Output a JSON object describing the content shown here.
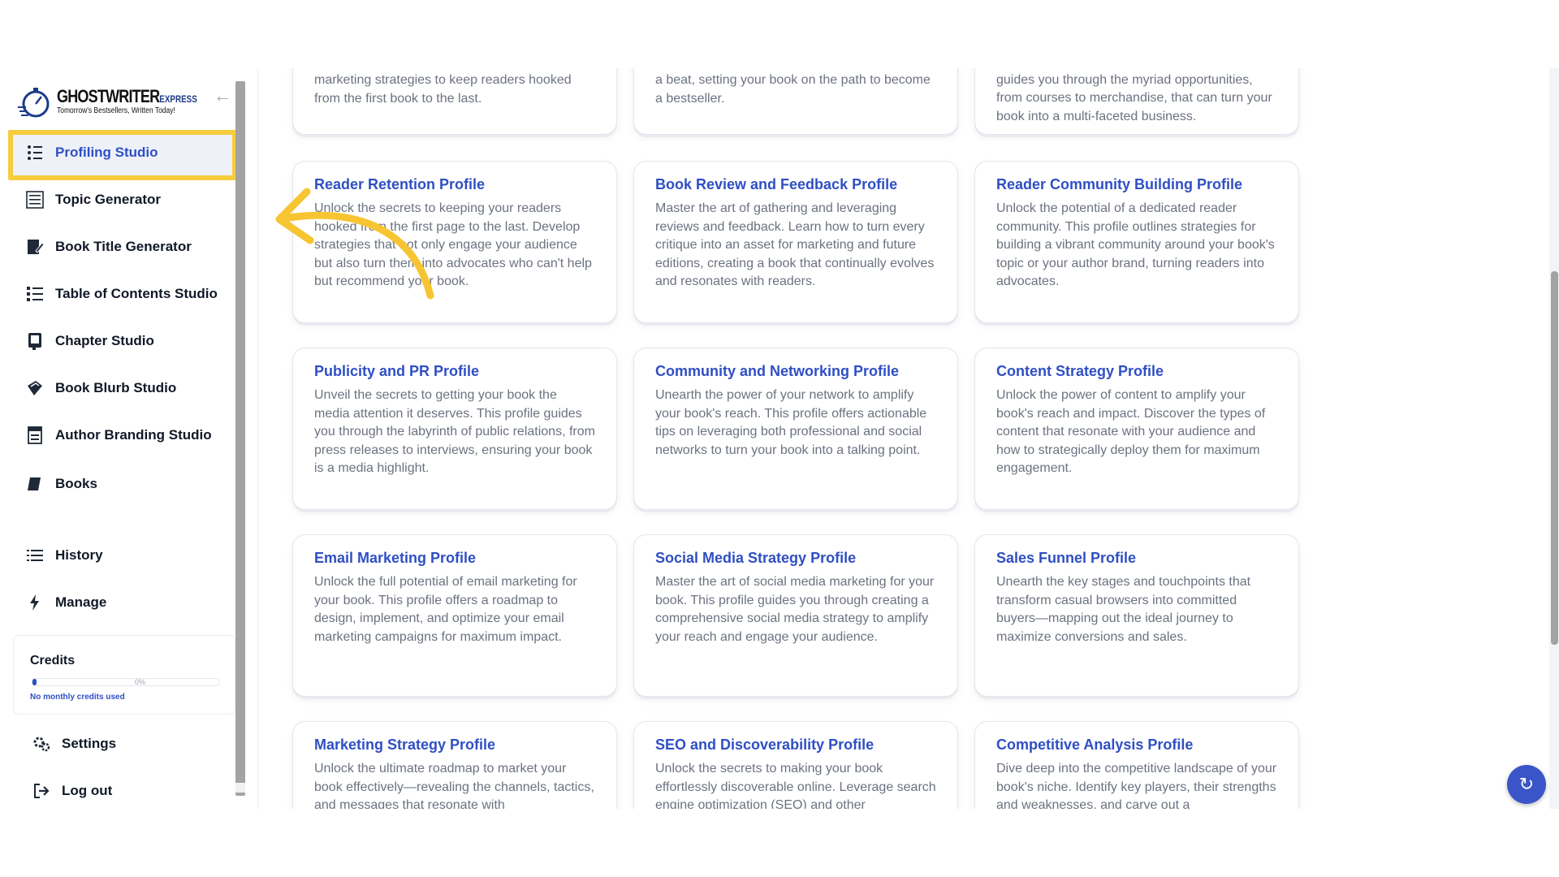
{
  "logo": {
    "name": "GHOSTWRITER",
    "suffix": "EXPRESS",
    "tagline": "Tomorrow's Bestsellers, Written Today!"
  },
  "sidebar": {
    "items": [
      {
        "label": "Profiling Studio",
        "icon": "profile-list-icon",
        "active": true
      },
      {
        "label": "Topic Generator",
        "icon": "list-board-icon"
      },
      {
        "label": "Book Title Generator",
        "icon": "book-edit-icon"
      },
      {
        "label": "Table of Contents Studio",
        "icon": "toc-list-icon"
      },
      {
        "label": "Chapter Studio",
        "icon": "chapter-book-icon"
      },
      {
        "label": "Book Blurb Studio",
        "icon": "blurb-book-icon"
      },
      {
        "label": "Author Branding Studio",
        "icon": "branding-icon"
      },
      {
        "label": "Books",
        "icon": "book-icon"
      },
      {
        "label": "History",
        "icon": "history-list-icon"
      },
      {
        "label": "Manage",
        "icon": "bolt-icon"
      },
      {
        "label": "Settings",
        "icon": "gears-icon"
      },
      {
        "label": "Log out",
        "icon": "logout-icon"
      }
    ],
    "credits": {
      "title": "Credits",
      "percent_label": "0%",
      "progress": 0.02,
      "note": "No monthly credits used"
    }
  },
  "cards_top": [
    {
      "desc": "marketing strategies to keep readers hooked from the first book to the last."
    },
    {
      "desc": "a beat, setting your book on the path to become a bestseller."
    },
    {
      "desc": "guides you through the myriad opportunities, from courses to merchandise, that can turn your book into a multi-faceted business."
    }
  ],
  "cards": [
    {
      "title": "Reader Retention Profile",
      "desc": "Unlock the secrets to keeping your readers hooked from the first page to the last. Develop strategies that not only engage your audience but also turn them into advocates who can't help but recommend your book."
    },
    {
      "title": "Book Review and Feedback Profile",
      "desc": "Master the art of gathering and leveraging reviews and feedback. Learn how to turn every critique into an asset for marketing and future editions, creating a book that continually evolves and resonates with readers."
    },
    {
      "title": "Reader Community Building Profile",
      "desc": "Unlock the potential of a dedicated reader community. This profile outlines strategies for building a vibrant community around your book's topic or your author brand, turning readers into advocates."
    },
    {
      "title": "Publicity and PR Profile",
      "desc": "Unveil the secrets to getting your book the media attention it deserves. This profile guides you through the labyrinth of public relations, from press releases to interviews, ensuring your book is a media highlight."
    },
    {
      "title": "Community and Networking Profile",
      "desc": "Unearth the power of your network to amplify your book's reach. This profile offers actionable tips on leveraging both professional and social networks to turn your book into a talking point."
    },
    {
      "title": "Content Strategy Profile",
      "desc": "Unlock the power of content to amplify your book's reach and impact. Discover the types of content that resonate with your audience and how to strategically deploy them for maximum engagement."
    },
    {
      "title": "Email Marketing Profile",
      "desc": "Unlock the full potential of email marketing for your book. This profile offers a roadmap to design, implement, and optimize your email marketing campaigns for maximum impact."
    },
    {
      "title": "Social Media Strategy Profile",
      "desc": "Master the art of social media marketing for your book. This profile guides you through creating a comprehensive social media strategy to amplify your reach and engage your audience."
    },
    {
      "title": "Sales Funnel Profile",
      "desc": "Unearth the key stages and touchpoints that transform casual browsers into committed buyers—mapping out the ideal journey to maximize conversions and sales."
    },
    {
      "title": "Marketing Strategy Profile",
      "desc": "Unlock the ultimate roadmap to market your book effectively—revealing the channels, tactics, and messages that resonate with"
    },
    {
      "title": "SEO and Discoverability Profile",
      "desc": "Unlock the secrets to making your book effortlessly discoverable online. Leverage search engine optimization (SEO) and other"
    },
    {
      "title": "Competitive Analysis Profile",
      "desc": "Dive deep into the competitive landscape of your book's niche. Identify key players, their strengths and weaknesses, and carve out a"
    }
  ],
  "colors": {
    "accent": "#2f4fc4",
    "highlight": "#f7cc3d",
    "annotation_arrow": "#f7c531"
  }
}
